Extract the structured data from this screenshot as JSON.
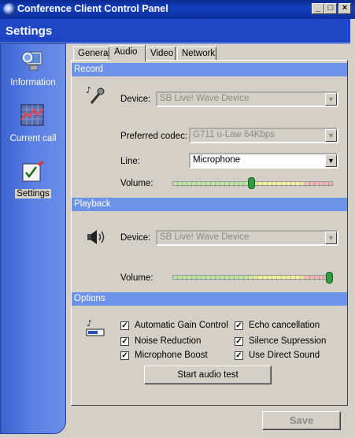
{
  "window": {
    "title": "Conference Client Control Panel",
    "minimize": "_",
    "maximize": "□",
    "close": "×"
  },
  "header": {
    "title": "Settings"
  },
  "sidebar": {
    "items": [
      {
        "label": "Information"
      },
      {
        "label": "Current call"
      },
      {
        "label": "Settings"
      }
    ]
  },
  "tabs": [
    {
      "label": "General"
    },
    {
      "label": "Audio"
    },
    {
      "label": "Video"
    },
    {
      "label": "Network"
    }
  ],
  "record": {
    "section": "Record",
    "device_label": "Device:",
    "device_value": "SB Live! Wave Device",
    "codec_label": "Preferred codec:",
    "codec_value": "G711 u-Law 64Kbps",
    "line_label": "Line:",
    "line_value": "Microphone",
    "volume_label": "Volume:",
    "volume_level": 0.49
  },
  "playback": {
    "section": "Playback",
    "device_label": "Device:",
    "device_value": "SB Live! Wave Device",
    "volume_label": "Volume:",
    "volume_level": 1.0
  },
  "options": {
    "section": "Options",
    "checkboxes": [
      {
        "label": "Automatic Gain Control",
        "checked": true
      },
      {
        "label": "Echo cancellation",
        "checked": true
      },
      {
        "label": "Noise Reduction",
        "checked": true
      },
      {
        "label": "Silence Supression",
        "checked": true
      },
      {
        "label": "Microphone Boost",
        "checked": true
      },
      {
        "label": "Use Direct Sound",
        "checked": true
      }
    ],
    "test_button": "Start audio test"
  },
  "footer": {
    "save": "Save"
  },
  "colors": {
    "title_bar": "#0a2a8c",
    "header": "#1f46c4",
    "sidebar": "#5b80e6",
    "section": "#6d93e8"
  }
}
